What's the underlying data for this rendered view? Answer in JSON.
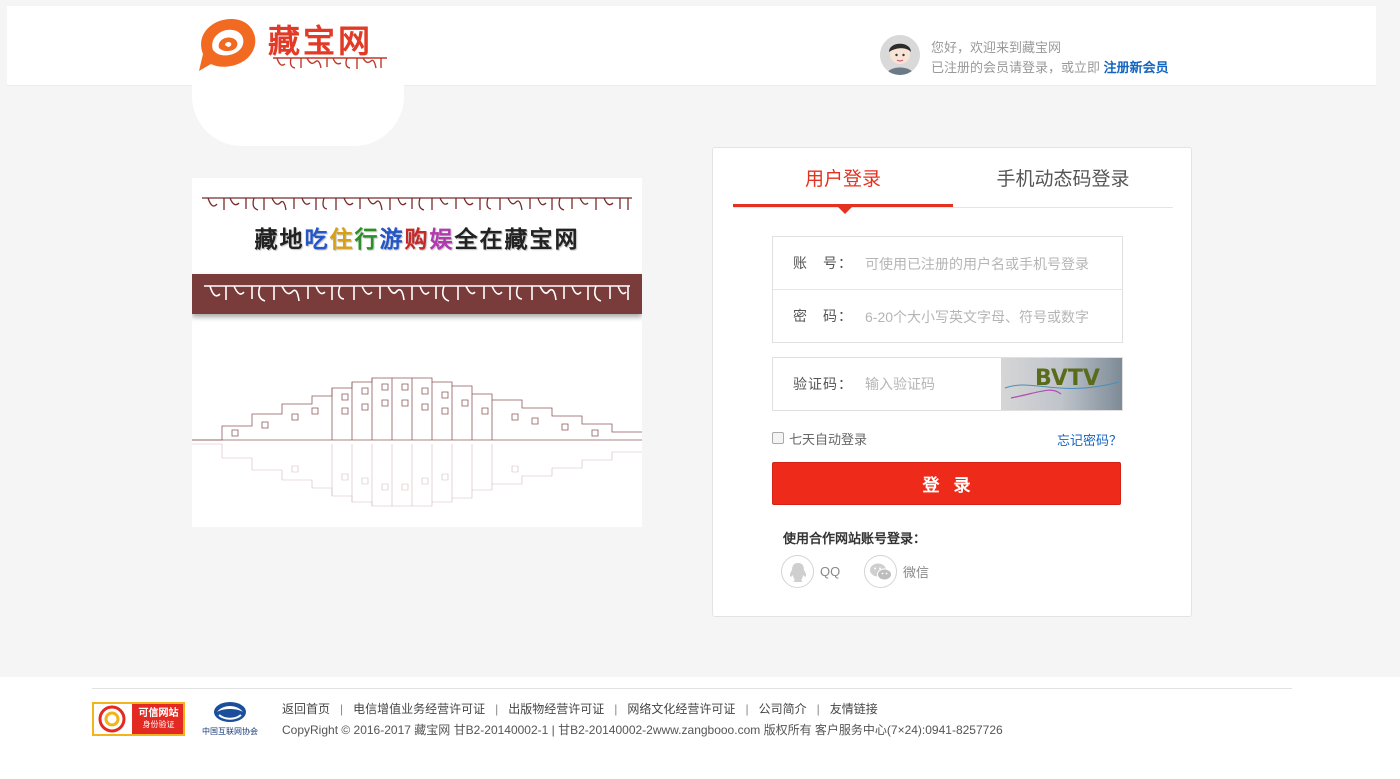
{
  "header": {
    "logo_text": "藏宝网",
    "greeting": "您好，欢迎来到藏宝网",
    "register_prompt": "已注册的会员请登录，或立即",
    "register_link": "注册新会员"
  },
  "banner": {
    "slogan_chars": [
      "藏",
      "地",
      "吃",
      "住",
      "行",
      "游",
      "购",
      "娱",
      "全",
      "在",
      "藏",
      "宝",
      "网"
    ],
    "slogan_colors": [
      "#222222",
      "#222222",
      "#2456c7",
      "#d8a115",
      "#2f8c2a",
      "#2456c7",
      "#c42a2a",
      "#b23ab0",
      "#222222",
      "#222222",
      "#222222",
      "#222222",
      "#222222"
    ]
  },
  "login": {
    "tabs": [
      {
        "label": "用户登录",
        "active": true
      },
      {
        "label": "手机动态码登录",
        "active": false
      }
    ],
    "account_label": "账　号：",
    "account_placeholder": "可使用已注册的用户名或手机号登录",
    "password_label": "密　码：",
    "password_placeholder": "6-20个大小写英文字母、符号或数字",
    "captcha_label": "验证码：",
    "captcha_placeholder": "输入验证码",
    "captcha_text": "BVTV",
    "remember_label": "七天自动登录",
    "forgot_label": "忘记密码？",
    "submit_label": "登录",
    "partner_title": "使用合作网站账号登录：",
    "partners": [
      {
        "label": "QQ",
        "icon": "qq-icon"
      },
      {
        "label": "微信",
        "icon": "wechat-icon"
      }
    ]
  },
  "footer": {
    "links": [
      "返回首页",
      "电信增值业务经营许可证",
      "出版物经营许可证",
      "网络文化经营许可证",
      "公司简介",
      "友情链接"
    ],
    "copyright": "CopyRight © 2016-2017 藏宝网 甘B2-20140002-1 | 甘B2-20140002-2www.zangbooo.com 版权所有 客户服务中心(7×24):0941-8257726",
    "trust_badge_title": "可信网站",
    "trust_badge_sub": "身份验证",
    "isc_label": "中国互联网协会"
  },
  "colors": {
    "accent": "#e5311f",
    "link": "#1565c0",
    "button": "#ee2b1a"
  }
}
